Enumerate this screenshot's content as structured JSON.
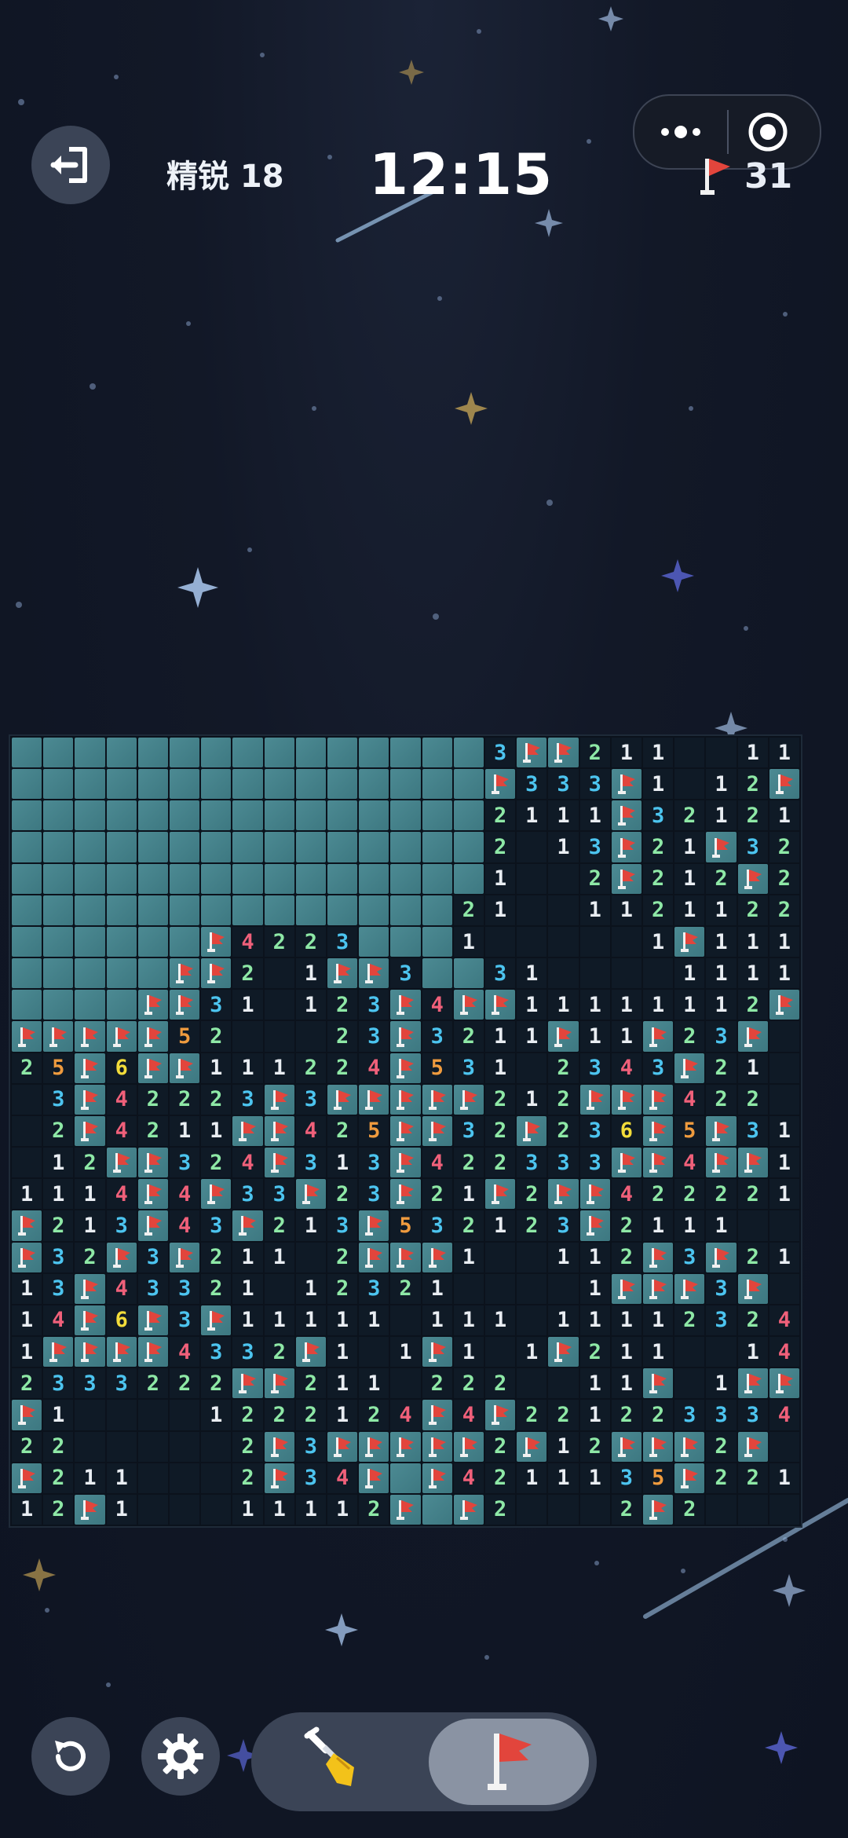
{
  "header": {
    "mode_label": "精锐 18",
    "timer": "12:15",
    "flags_remaining": "31"
  },
  "icons": {
    "exit": "exit-icon",
    "more": "more-dots-icon",
    "target": "target-icon",
    "flag": "flag-icon",
    "undo": "undo-icon",
    "settings": "gear-icon",
    "shovel": "shovel-icon"
  },
  "colors": {
    "hidden_cell": "#4c8a93",
    "open_cell": "#0f1a26",
    "n1": "#e9edf2",
    "n2": "#8ee8a6",
    "n3": "#4cc4ef",
    "n4": "#f0607a",
    "n5": "#ef9b3e",
    "n6": "#f2dc3a",
    "flag_red": "#e2453c"
  },
  "board": {
    "cols": 25,
    "rows": [
      "###############3FF211..11",
      "###############F333F1.12F",
      "###############2111F32121",
      "###############2.13F21F32",
      "###############1..2F212F2",
      "##############21..1121122",
      "######F4223###1.....1F111",
      "#####FF2.1FF3##31....1111",
      "####FF31.123F4FF11111112F",
      "FFFFF52...23F3211F11F23F",
      "25F6FF111224F531.2343F21",
      ".3F42223F3FFFFF212FFF422.",
      ".2F4211FF425FF32F236F5F31",
      ".12FF324F313F422333FF4FF1",
      "1114F4F33F23F21F2FF42222 1",
      "F213F43F213F532123F2111..",
      "F32F3F211.2FFF1..112F3F21",
      "13F4332 1.1232 1....1FFF3F",
      "14F6F3F11111.111.11112324F",
      "1FFFF4332F1.1F1.1F211..14F",
      "2333222FF211.222..11F.1FF",
      "F1....1222124F4F22122333 43",
      "22.....2F3FFFFF2F12FFF2F",
      "F211...2F34F#F4211135F221",
      "12F1...11112F#F2...2F2..."
    ]
  }
}
